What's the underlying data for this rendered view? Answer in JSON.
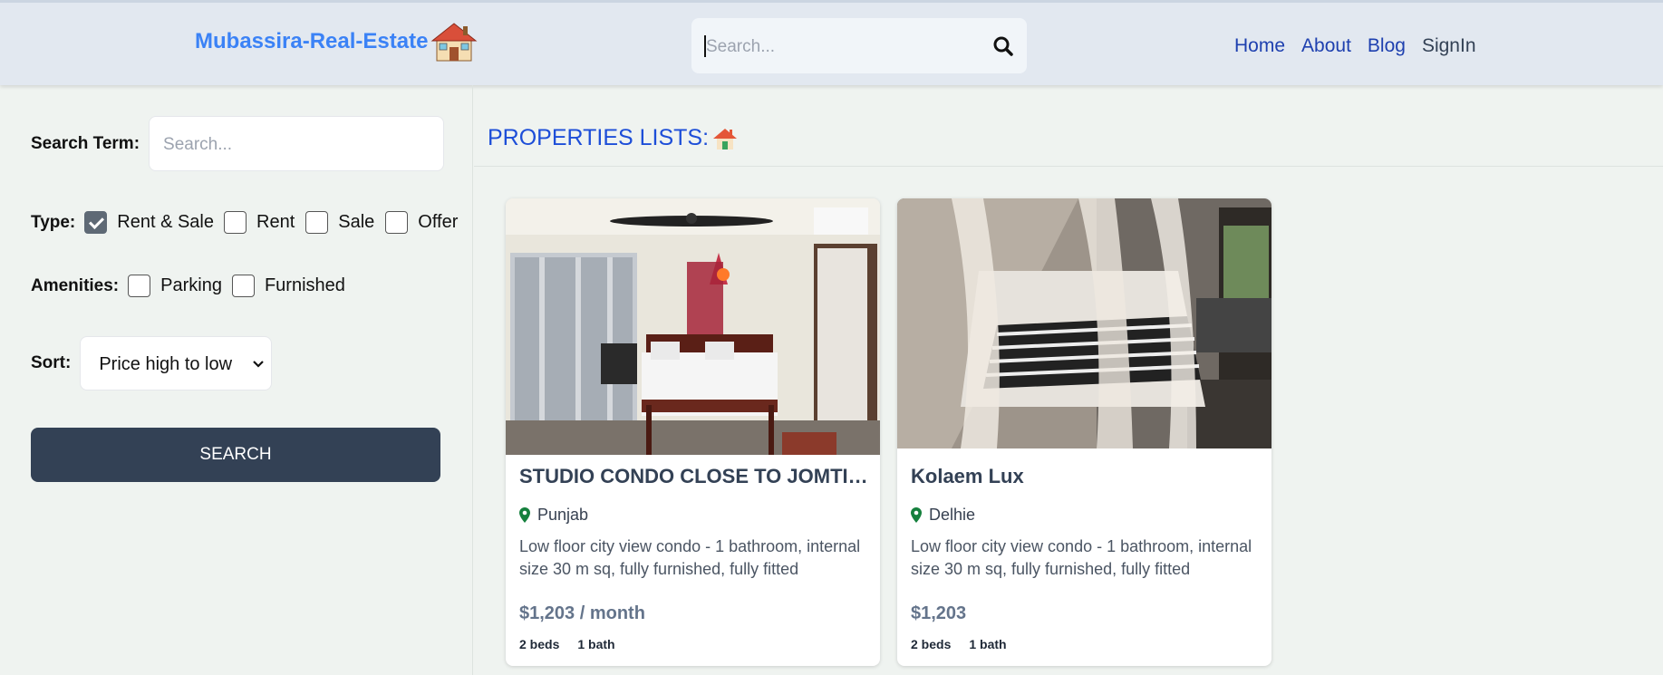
{
  "header": {
    "brand": "Mubassira-Real-Estate",
    "search_placeholder": "Search...",
    "nav": [
      "Home",
      "About",
      "Blog",
      "SignIn"
    ]
  },
  "sidebar": {
    "search_term_label": "Search Term:",
    "search_term_placeholder": "Search...",
    "type_label": "Type:",
    "type_options": [
      {
        "label": "Rent & Sale",
        "checked": true
      },
      {
        "label": "Rent",
        "checked": false
      },
      {
        "label": "Sale",
        "checked": false
      },
      {
        "label": "Offer",
        "checked": false
      }
    ],
    "amenities_label": "Amenities:",
    "amenities_options": [
      {
        "label": "Parking",
        "checked": false
      },
      {
        "label": "Furnished",
        "checked": false
      }
    ],
    "sort_label": "Sort:",
    "sort_value": "Price high to low",
    "search_button": "SEARCH"
  },
  "main": {
    "title": "PROPERTIES LISTS:",
    "listings": [
      {
        "title": "STUDIO CONDO CLOSE TO JOMTIEN BEACH",
        "location": "Punjab",
        "description": "Low floor city view condo - 1 bathroom, internal size 30 m sq, fully furnished, fully fitted kitchen,...",
        "price": "$1,203 / month",
        "beds": "2 beds",
        "baths": "1 bath"
      },
      {
        "title": "Kolaem Lux",
        "location": "Delhie",
        "description": "Low floor city view condo - 1 bathroom, internal size 30 m sq, fully furnished, fully fitted kitchen,...",
        "price": "$1,203",
        "beds": "2 beds",
        "baths": "1 bath"
      }
    ]
  }
}
